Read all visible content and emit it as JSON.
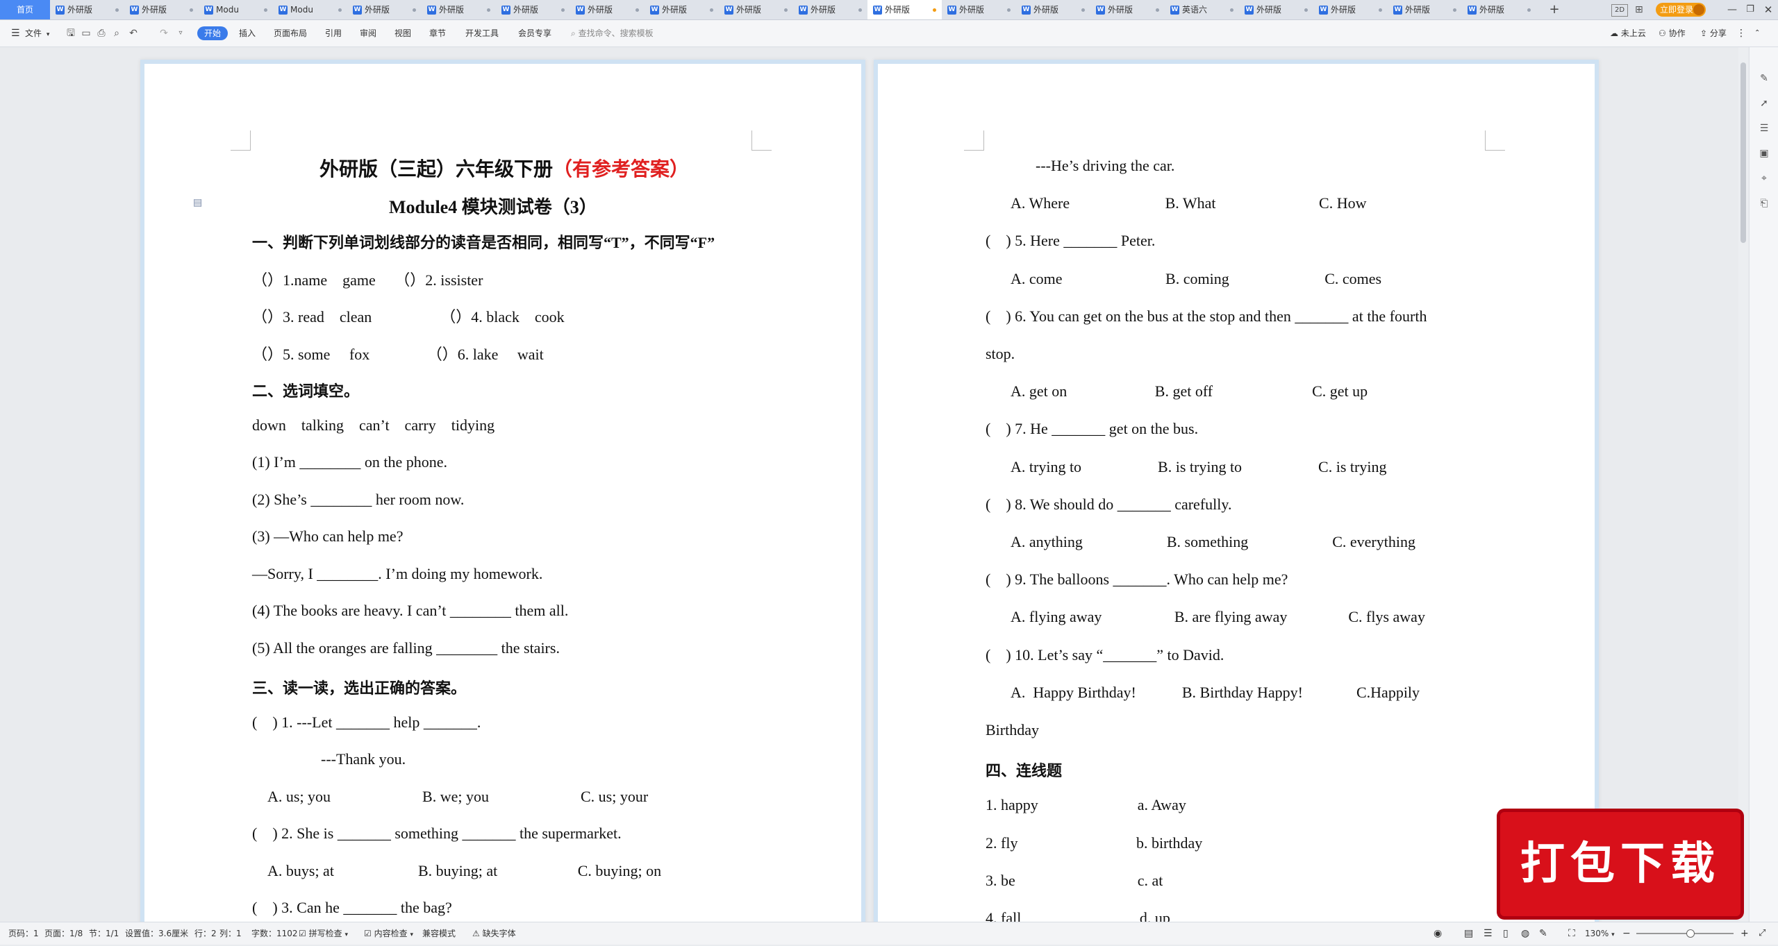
{
  "tabs": [
    {
      "label": "首页",
      "active": false,
      "home": true
    },
    {
      "label": "外研版",
      "active": false
    },
    {
      "label": "外研版",
      "active": false
    },
    {
      "label": "Modu",
      "active": false
    },
    {
      "label": "Modu",
      "active": false
    },
    {
      "label": "外研版",
      "active": false
    },
    {
      "label": "外研版",
      "active": false
    },
    {
      "label": "外研版",
      "active": false
    },
    {
      "label": "外研版",
      "active": false
    },
    {
      "label": "外研版",
      "active": false
    },
    {
      "label": "外研版",
      "active": false
    },
    {
      "label": "外研版",
      "active": false
    },
    {
      "label": "外研版",
      "active": true
    },
    {
      "label": "外研版",
      "active": false
    },
    {
      "label": "外研版",
      "active": false
    },
    {
      "label": "外研版",
      "active": false
    },
    {
      "label": "英语六",
      "active": false
    },
    {
      "label": "外研版",
      "active": false
    },
    {
      "label": "外研版",
      "active": false
    },
    {
      "label": "外研版",
      "active": false
    },
    {
      "label": "外研版",
      "active": false
    }
  ],
  "titlebar": {
    "new_tab": "+",
    "login": "立即登录",
    "layout_label": "2D"
  },
  "ribbon": {
    "file_menu": "文件",
    "tabs": [
      "开始",
      "插入",
      "页面布局",
      "引用",
      "审阅",
      "视图",
      "章节",
      "开发工具",
      "会员专享"
    ],
    "search_placeholder": "查找命令、搜索模板",
    "cloud": "未上云",
    "collab": "协作",
    "share": "分享"
  },
  "left_page": {
    "title_main": "外研版（三起）六年级下册",
    "title_red": "（有参考答案）",
    "subtitle": "Module4  模块测试卷（3）",
    "lines": [
      {
        "text": "一、判断下列单词划线部分的读音是否相同，相同写“T”，不同写“F”",
        "heading": true
      },
      {
        "text": "（）1.name    game     （）2. issister"
      },
      {
        "text": "（）3. read    clean                  （）4. black    cook"
      },
      {
        "text": "（）5. some     fox               （）6. lake     wait"
      },
      {
        "text": "二、选词填空。",
        "heading": true
      },
      {
        "text": "down    talking    can’t    carry    tidying"
      },
      {
        "text": "(1) I’m ________ on the phone."
      },
      {
        "text": "(2) She’s ________ her room now."
      },
      {
        "text": "(3) —Who can help me?"
      },
      {
        "text": "—Sorry, I ________. I’m doing my homework."
      },
      {
        "text": "(4) The books are heavy. I can’t ________ them all."
      },
      {
        "text": "(5) All the oranges are falling ________ the stairs."
      },
      {
        "text": "三、读一读，选出正确的答案。",
        "heading": true
      },
      {
        "text": "(    ) 1. ---Let _______ help _______."
      },
      {
        "text": "          ---Thank you.",
        "indent": 44
      },
      {
        "text": "A. us; you                        B. we; you                        C. us; your",
        "indent": 22
      },
      {
        "text": "(    ) 2. She is _______ something _______ the supermarket."
      },
      {
        "text": "A. buys; at                      B. buying; at                     C. buying; on",
        "indent": 22
      },
      {
        "text": "(    ) 3. Can he _______ the bag?"
      }
    ]
  },
  "right_page": {
    "lines": [
      {
        "text": "---He’s driving the car.",
        "indent": 72
      },
      {
        "text": "A. Where                         B. What                           C. How",
        "indent": 36
      },
      {
        "text": "(    ) 5. Here _______ Peter."
      },
      {
        "text": "A. come                           B. coming                         C. comes",
        "indent": 36
      },
      {
        "text": "(    ) 6. You can get on the bus at the stop and then _______ at the fourth"
      },
      {
        "text": "stop."
      },
      {
        "text": "A. get on                       B. get off                          C. get up",
        "indent": 36
      },
      {
        "text": "(    ) 7. He _______ get on the bus."
      },
      {
        "text": "A. trying to                    B. is trying to                    C. is trying",
        "indent": 36
      },
      {
        "text": "(    ) 8. We should do _______ carefully."
      },
      {
        "text": "A. anything                      B. something                      C. everything",
        "indent": 36
      },
      {
        "text": "(    ) 9. The balloons _______. Who can help me?"
      },
      {
        "text": "A. flying away                   B. are flying away                C. flys away",
        "indent": 36
      },
      {
        "text": "(    ) 10. Let’s say “_______” to David."
      },
      {
        "text": "A.  Happy Birthday!            B. Birthday Happy!              C.Happily",
        "indent": 36
      },
      {
        "text": "Birthday"
      },
      {
        "text": "四、连线题",
        "heading": true
      },
      {
        "text": "1. happy                          a. Away"
      },
      {
        "text": "2. fly                               b. birthday"
      },
      {
        "text": "3. be                                c. at"
      },
      {
        "text": "4. fall                               d. up"
      }
    ]
  },
  "status": {
    "page_no": "页码：1",
    "pages": "页面：1/8",
    "section": "节：1/1",
    "setting": "设置值：3.6厘米",
    "row": "行：2",
    "col": "列：1",
    "words": "字数：1102",
    "spell": "拼写检查",
    "content_check": "内容检查",
    "compat": "兼容模式",
    "missing_font": "缺失字体",
    "zoom": "130%"
  },
  "badge": {
    "text": "打包下载"
  },
  "colors": {
    "accent": "#3a7bea",
    "title_red": "#e02020",
    "badge_red": "#d8101a"
  }
}
